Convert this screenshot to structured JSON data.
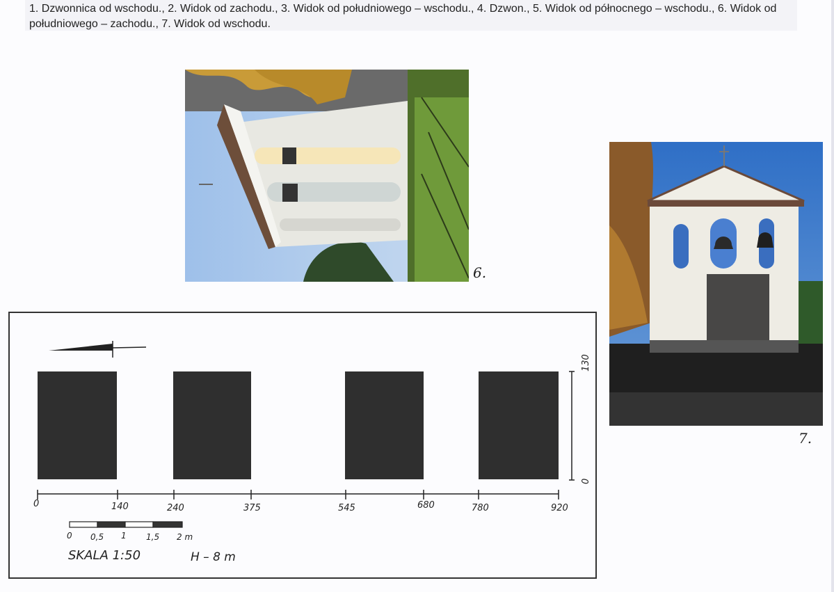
{
  "caption": "1. Dzwonnica od wschodu., 2. Widok od zachodu., 3. Widok od południowego – wschodu., 4. Dzwon., 5. Widok od północnego – wschodu., 6. Widok od południowego – zachodu., 7. Widok od wschodu.",
  "photo_labels": {
    "photo6": "6.",
    "photo7": "7."
  },
  "plan": {
    "dimensions": [
      "0",
      "140",
      "240",
      "375",
      "545",
      "680",
      "780",
      "920"
    ],
    "height_dims": [
      "130",
      "0"
    ],
    "scale_bar_labels": [
      "0",
      "0,5",
      "1",
      "1,5",
      "2 m"
    ],
    "scale_text": "SKALA  1:50",
    "height_text": "H – 8 m"
  },
  "colors": {
    "pillar": "#2f2f2f",
    "sky": "#3c78c8",
    "wall": "#efefea",
    "grass": "#6f9a3a",
    "foliage": "#c89a3a"
  }
}
